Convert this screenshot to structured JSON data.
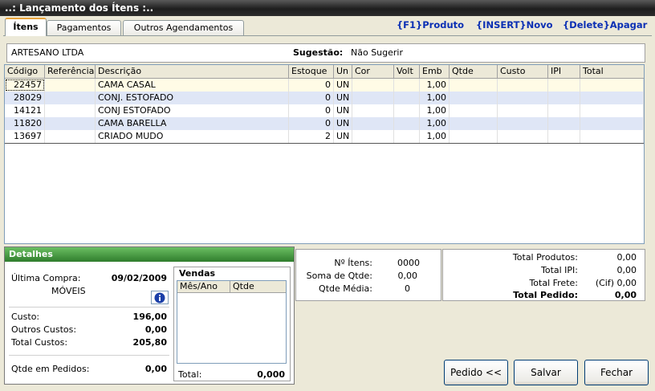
{
  "window": {
    "title": "..: Lançamento dos Ítens :.."
  },
  "tabs": [
    {
      "label": "Ítens",
      "active": true
    },
    {
      "label": "Pagamentos",
      "active": false
    },
    {
      "label": "Outros Agendamentos",
      "active": false
    }
  ],
  "shortcuts": {
    "produto": "{F1}Produto",
    "novo": "{INSERT}Novo",
    "apagar": "{Delete}Apagar"
  },
  "customer": {
    "name": "ARTESANO LTDA",
    "suggestion_label": "Sugestão:",
    "suggestion_value": "Não Sugerir"
  },
  "grid": {
    "columns": [
      "Código",
      "Referência",
      "Descrição",
      "Estoque",
      "Un",
      "Cor",
      "Volt",
      "Emb",
      "Qtde",
      "Custo",
      "IPI",
      "Total"
    ],
    "rows": [
      {
        "codigo": "22457",
        "referencia": "",
        "descricao": "CAMA CASAL",
        "estoque": "0",
        "un": "UN",
        "cor": "",
        "volt": "",
        "emb": "1,00",
        "qtde": "",
        "custo": "",
        "ipi": "",
        "total": ""
      },
      {
        "codigo": "28029",
        "referencia": "",
        "descricao": "CONJ. ESTOFADO",
        "estoque": "0",
        "un": "UN",
        "cor": "",
        "volt": "",
        "emb": "1,00",
        "qtde": "",
        "custo": "",
        "ipi": "",
        "total": ""
      },
      {
        "codigo": "14121",
        "referencia": "",
        "descricao": "CONJ ESTOFADO",
        "estoque": "0",
        "un": "UN",
        "cor": "",
        "volt": "",
        "emb": "1,00",
        "qtde": "",
        "custo": "",
        "ipi": "",
        "total": ""
      },
      {
        "codigo": "11820",
        "referencia": "",
        "descricao": "CAMA BARELLA",
        "estoque": "0",
        "un": "UN",
        "cor": "",
        "volt": "",
        "emb": "1,00",
        "qtde": "",
        "custo": "",
        "ipi": "",
        "total": ""
      },
      {
        "codigo": "13697",
        "referencia": "",
        "descricao": "CRIADO MUDO",
        "estoque": "2",
        "un": "UN",
        "cor": "",
        "volt": "",
        "emb": "1,00",
        "qtde": "",
        "custo": "",
        "ipi": "",
        "total": ""
      }
    ]
  },
  "details": {
    "title": "Detalhes",
    "ultima_compra_label": "Última Compra:",
    "ultima_compra_date": "09/02/2009",
    "category": "MÓVEIS",
    "custo_label": "Custo:",
    "custo_value": "196,00",
    "outros_custos_label": "Outros Custos:",
    "outros_custos_value": "0,00",
    "total_custos_label": "Total Custos:",
    "total_custos_value": "205,80",
    "qtde_pedidos_label": "Qtde em Pedidos:",
    "qtde_pedidos_value": "0,00",
    "vendas": {
      "title": "Vendas",
      "columns": [
        "Mês/Ano",
        "Qtde"
      ],
      "total_label": "Total:",
      "total_value": "0,000"
    }
  },
  "summary_mid": {
    "num_itens_label": "Nº Ítens:",
    "num_itens_value": "0000",
    "soma_qtde_label": "Soma de Qtde:",
    "soma_qtde_value": "0,00",
    "qtde_media_label": "Qtde Média:",
    "qtde_media_value": "0"
  },
  "summary_right": {
    "total_produtos_label": "Total Produtos:",
    "total_produtos_value": "0,00",
    "total_ipi_label": "Total IPI:",
    "total_ipi_value": "0,00",
    "total_frete_label": "Total Frete:",
    "total_frete_value": "(Cif) 0,00",
    "total_pedido_label": "Total Pedido:",
    "total_pedido_value": "0,00"
  },
  "buttons": {
    "pedido": "Pedido <<",
    "salvar": "Salvar",
    "fechar": "Fechar"
  },
  "colors": {
    "row_selected": "#fffbe6",
    "row_alt": "#dfe6f6",
    "shortcut_text": "#0a2fb4",
    "details_header": "#2f7d2c"
  }
}
